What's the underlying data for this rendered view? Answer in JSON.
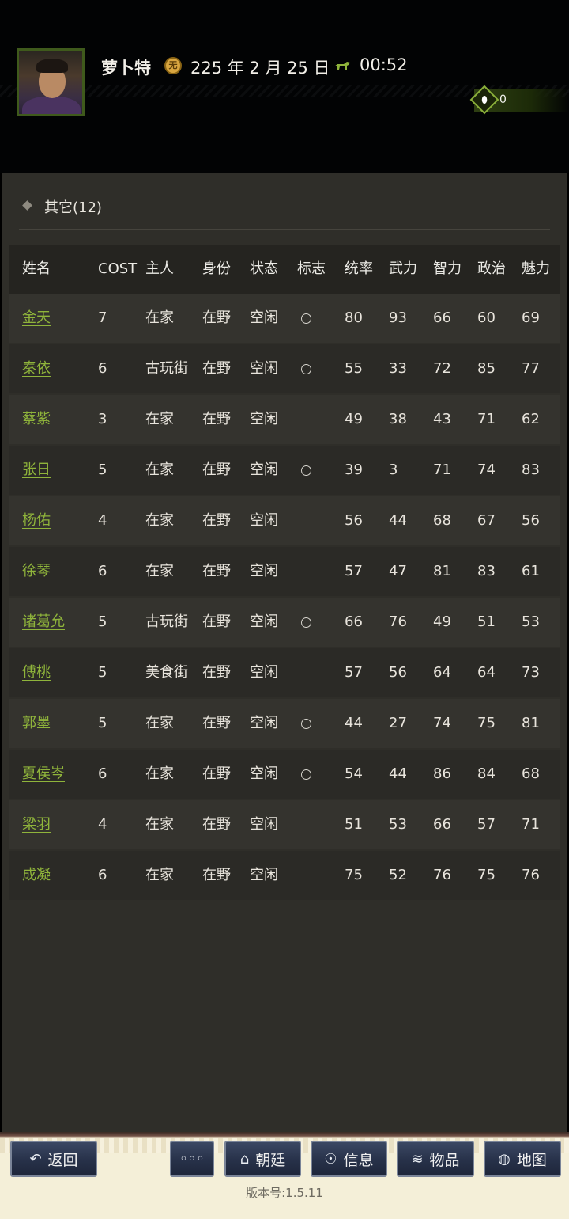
{
  "header": {
    "player_name": "萝卜特",
    "date": "225 年 2 月 25 日",
    "time": "00:52",
    "resource_count": "0",
    "coin_glyph": "无",
    "resource_glyph": "⬮"
  },
  "section": {
    "title": "其它(12)"
  },
  "table": {
    "columns": [
      "姓名",
      "COST",
      "主人",
      "身份",
      "状态",
      "标志",
      "统率",
      "武力",
      "智力",
      "政治",
      "魅力"
    ],
    "rows": [
      {
        "name": "金天",
        "cost": "7",
        "master": "在家",
        "identity": "在野",
        "state": "空闲",
        "flag": true,
        "s1": "80",
        "s2": "93",
        "s3": "66",
        "s4": "60",
        "s5": "69"
      },
      {
        "name": "秦依",
        "cost": "6",
        "master": "古玩街",
        "identity": "在野",
        "state": "空闲",
        "flag": true,
        "s1": "55",
        "s2": "33",
        "s3": "72",
        "s4": "85",
        "s5": "77"
      },
      {
        "name": "蔡紫",
        "cost": "3",
        "master": "在家",
        "identity": "在野",
        "state": "空闲",
        "flag": false,
        "s1": "49",
        "s2": "38",
        "s3": "43",
        "s4": "71",
        "s5": "62"
      },
      {
        "name": "张日",
        "cost": "5",
        "master": "在家",
        "identity": "在野",
        "state": "空闲",
        "flag": true,
        "s1": "39",
        "s2": "3",
        "s3": "71",
        "s4": "74",
        "s5": "83"
      },
      {
        "name": "杨佑",
        "cost": "4",
        "master": "在家",
        "identity": "在野",
        "state": "空闲",
        "flag": false,
        "s1": "56",
        "s2": "44",
        "s3": "68",
        "s4": "67",
        "s5": "56"
      },
      {
        "name": "徐琴",
        "cost": "6",
        "master": "在家",
        "identity": "在野",
        "state": "空闲",
        "flag": false,
        "s1": "57",
        "s2": "47",
        "s3": "81",
        "s4": "83",
        "s5": "61"
      },
      {
        "name": "诸葛允",
        "cost": "5",
        "master": "古玩街",
        "identity": "在野",
        "state": "空闲",
        "flag": true,
        "s1": "66",
        "s2": "76",
        "s3": "49",
        "s4": "51",
        "s5": "53"
      },
      {
        "name": "傅桃",
        "cost": "5",
        "master": "美食街",
        "identity": "在野",
        "state": "空闲",
        "flag": false,
        "s1": "57",
        "s2": "56",
        "s3": "64",
        "s4": "64",
        "s5": "73"
      },
      {
        "name": "郭墨",
        "cost": "5",
        "master": "在家",
        "identity": "在野",
        "state": "空闲",
        "flag": true,
        "s1": "44",
        "s2": "27",
        "s3": "74",
        "s4": "75",
        "s5": "81"
      },
      {
        "name": "夏侯岑",
        "cost": "6",
        "master": "在家",
        "identity": "在野",
        "state": "空闲",
        "flag": true,
        "s1": "54",
        "s2": "44",
        "s3": "86",
        "s4": "84",
        "s5": "68"
      },
      {
        "name": "梁羽",
        "cost": "4",
        "master": "在家",
        "identity": "在野",
        "state": "空闲",
        "flag": false,
        "s1": "51",
        "s2": "53",
        "s3": "66",
        "s4": "57",
        "s5": "71"
      },
      {
        "name": "成凝",
        "cost": "6",
        "master": "在家",
        "identity": "在野",
        "state": "空闲",
        "flag": false,
        "s1": "75",
        "s2": "52",
        "s3": "76",
        "s4": "75",
        "s5": "76"
      }
    ]
  },
  "footer": {
    "buttons": [
      {
        "label": "返回",
        "icon": "↶",
        "icon_name": "back-icon"
      },
      {
        "label": "",
        "icon": "◦◦◦",
        "icon_name": "more-icon"
      },
      {
        "label": "朝廷",
        "icon": "⌂",
        "icon_name": "court-icon"
      },
      {
        "label": "信息",
        "icon": "☉",
        "icon_name": "message-icon"
      },
      {
        "label": "物品",
        "icon": "≋",
        "icon_name": "items-icon"
      },
      {
        "label": "地图",
        "icon": "◍",
        "icon_name": "map-icon"
      }
    ],
    "version": "版本号:1.5.11"
  },
  "colors": {
    "name_link": "#8fb43b",
    "panel_bg": "#2f2e29",
    "button_bg": "#273149"
  }
}
